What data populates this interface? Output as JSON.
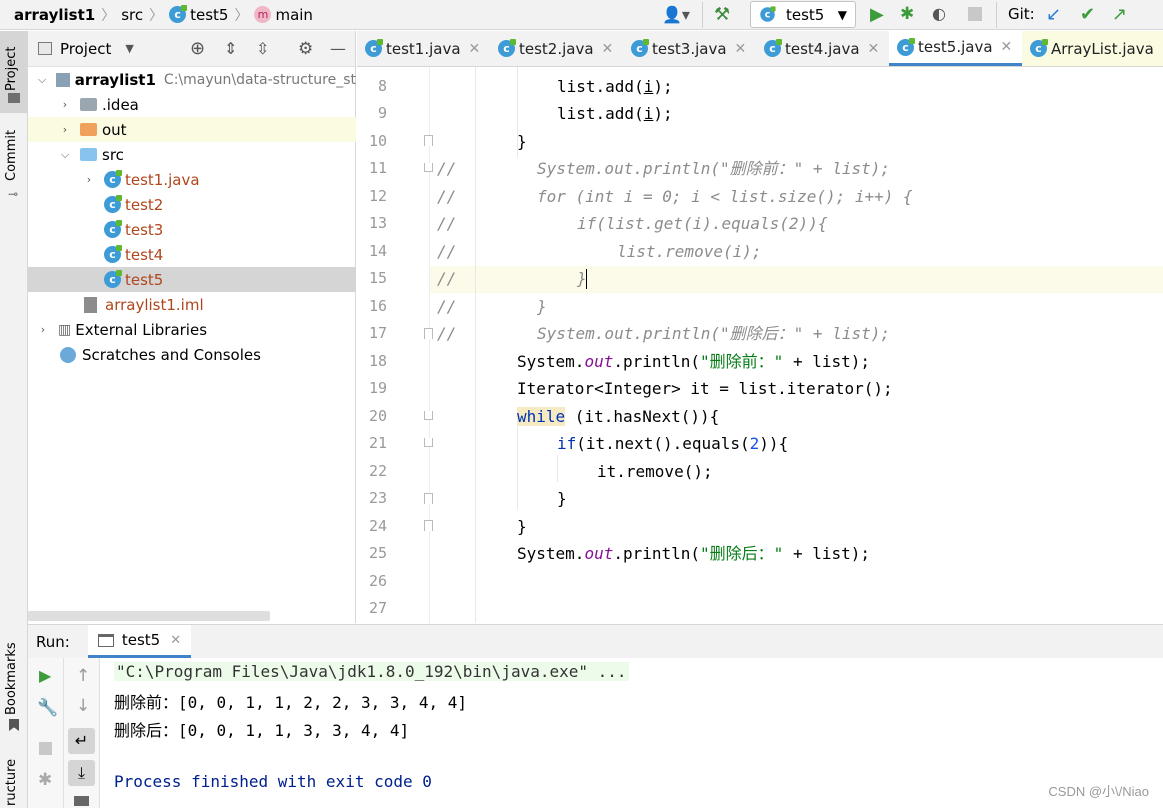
{
  "breadcrumb": {
    "project": "arraylist1",
    "src": "src",
    "cls": "test5",
    "method": "main"
  },
  "toolbar": {
    "run_config": "test5",
    "git_label": "Git:"
  },
  "left_stripe": {
    "project": "Project",
    "commit": "Commit",
    "bookmarks": "Bookmarks",
    "structure": "ructure"
  },
  "project_panel": {
    "title": "Project",
    "root": {
      "name": "arraylist1",
      "path": "C:\\mayun\\data-structure_st"
    },
    "items": [
      {
        "label": "arraylist1",
        "indent": 0,
        "arrow": "down",
        "type": "module"
      },
      {
        "label": ".idea",
        "indent": 1,
        "arrow": "right",
        "type": "folder-gray"
      },
      {
        "label": "out",
        "indent": 1,
        "arrow": "right",
        "type": "folder-orange"
      },
      {
        "label": "src",
        "indent": 1,
        "arrow": "down",
        "type": "folder-blue"
      },
      {
        "label": "test1.java",
        "indent": 2,
        "arrow": "right",
        "type": "class"
      },
      {
        "label": "test2",
        "indent": 2,
        "arrow": "",
        "type": "class"
      },
      {
        "label": "test3",
        "indent": 2,
        "arrow": "",
        "type": "class"
      },
      {
        "label": "test4",
        "indent": 2,
        "arrow": "",
        "type": "class"
      },
      {
        "label": "test5",
        "indent": 2,
        "arrow": "",
        "type": "class"
      },
      {
        "label": "arraylist1.iml",
        "indent": 1,
        "arrow": "",
        "type": "iml"
      },
      {
        "label": "External Libraries",
        "indent": 0,
        "arrow": "right",
        "type": "lib"
      },
      {
        "label": "Scratches and Consoles",
        "indent": 0,
        "arrow": "",
        "type": "scratch"
      }
    ]
  },
  "tabs": [
    {
      "label": "test1.java",
      "active": false
    },
    {
      "label": "test2.java",
      "active": false
    },
    {
      "label": "test3.java",
      "active": false
    },
    {
      "label": "test4.java",
      "active": false
    },
    {
      "label": "test5.java",
      "active": true
    },
    {
      "label": "ArrayList.java",
      "active": false
    }
  ],
  "editor": {
    "line_numbers": [
      "8",
      "9",
      "10",
      "11",
      "12",
      "13",
      "14",
      "15",
      "16",
      "17",
      "18",
      "19",
      "20",
      "21",
      "22",
      "23",
      "24",
      "25",
      "26",
      "27"
    ],
    "current_line": "15"
  },
  "run_panel": {
    "label": "Run:",
    "tab": "test5",
    "console": [
      "\"C:\\Program Files\\Java\\jdk1.8.0_192\\bin\\java.exe\" ...",
      "删除前：[0, 0, 1, 1, 2, 2, 3, 3, 4, 4]",
      "删除后：[0, 0, 1, 1, 3, 3, 4, 4]",
      "",
      "Process finished with exit code 0"
    ]
  },
  "watermark": "CSDN @小\\/Niao",
  "colors": {
    "accent": "#4083c9",
    "keyword": "#0033b3",
    "string": "#067d17",
    "comment": "#8c8c8c",
    "field": "#871094",
    "selection": "#d5d5d5",
    "current_line": "#fcfae8"
  }
}
